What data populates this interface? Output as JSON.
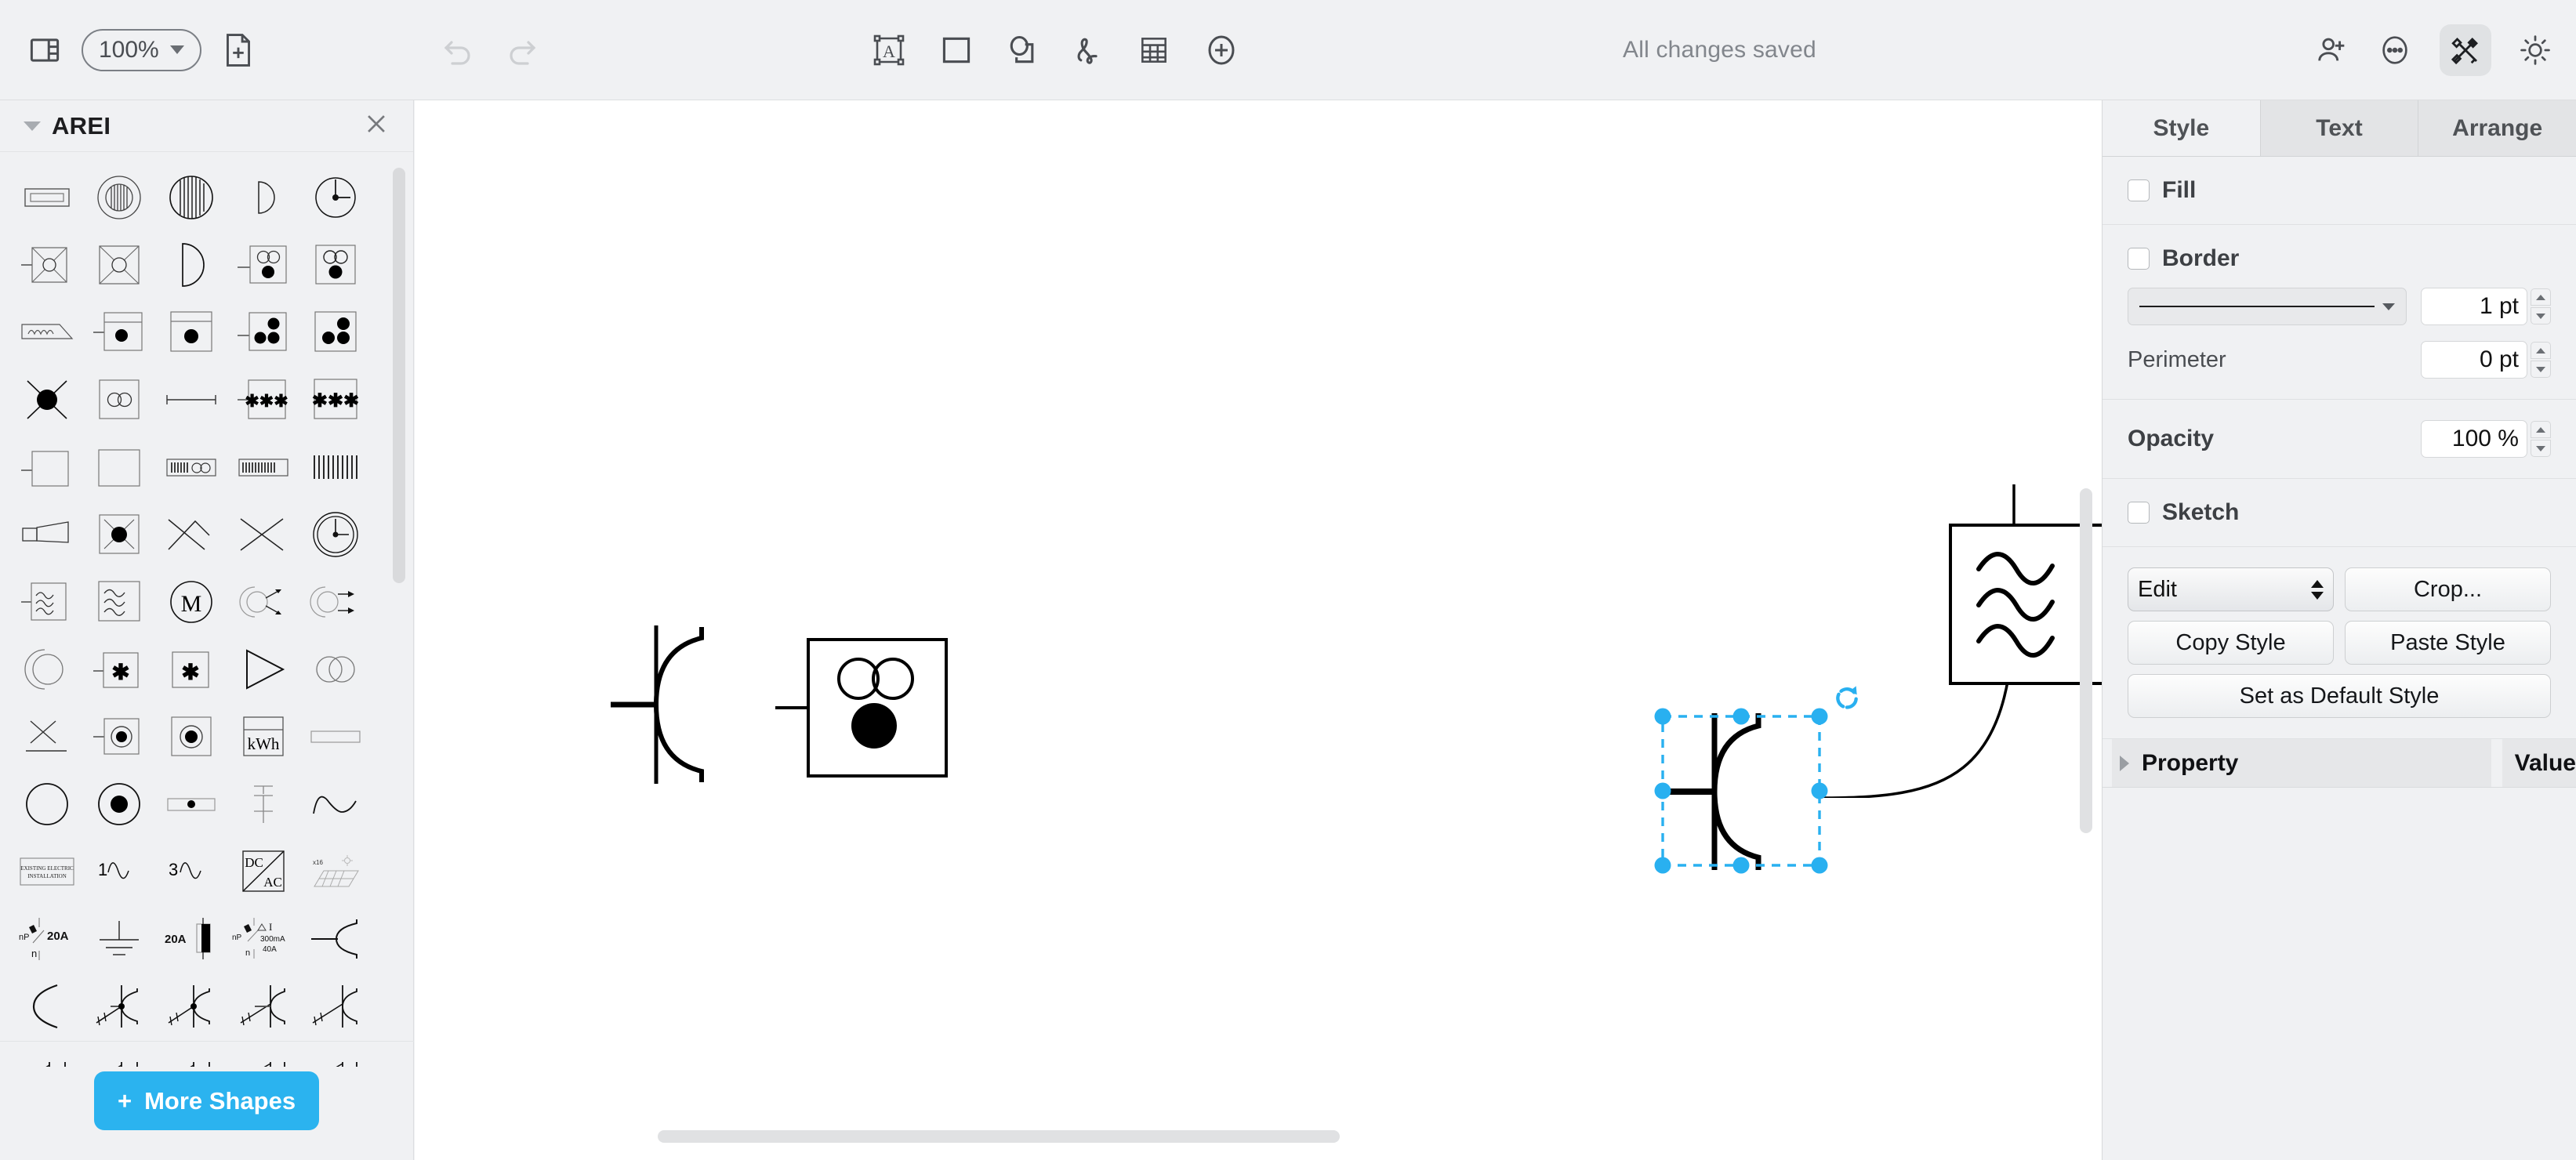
{
  "toolbar": {
    "zoom_value": "100%",
    "icons": {
      "layout_panel": "panel-layout-icon",
      "new_page": "new-page-icon",
      "undo": "undo-icon",
      "redo": "redo-icon",
      "text": "text-box-icon",
      "rectangle": "rectangle-icon",
      "shapes": "shape-icon",
      "freehand": "freehand-icon",
      "table": "table-icon",
      "add": "plus-circle-icon",
      "share": "add-person-icon",
      "more": "more-options-icon",
      "format": "format-tools-icon",
      "theme": "sun-icon"
    },
    "status": "All changes saved"
  },
  "left_panel": {
    "palette_title": "AREI",
    "close_label": "×",
    "more_shapes_label": "More Shapes",
    "more_shapes_plus": "+",
    "shape_labels": [
      "socket-flush",
      "ventilator-round-outlet",
      "ventilator-round",
      "half-disc-small",
      "clock-meter",
      "crossed-box-circle",
      "crossed-box-circle-large",
      "half-disc",
      "socket-two-circles",
      "box-two-circles-dot",
      "inductor-wedge",
      "box-dot-lamp",
      "box-dot-lamp-large",
      "box-three-dots",
      "box-three-dots-large",
      "junction-star-dot",
      "box-two-circles",
      "line-terminated",
      "box-three-asterisks",
      "box-three-asterisks-large",
      "open-rect",
      "plain-rect",
      "heater-with-circles",
      "heater-element",
      "heater-bars",
      "speaker-horn",
      "box-junction-dot",
      "crossed-lines-bent",
      "crossed-lines",
      "gauge-clock",
      "box-waves",
      "box-waves-large",
      "motor-m",
      "rotary-actuator-two-arrows",
      "rotary-actuator-arrows",
      "circle-arc",
      "box-asterisk-lamp",
      "box-asterisk",
      "amplifier-triangle",
      "two-circles-overlap",
      "cross-on-line",
      "box-circle-dot",
      "box-circle-dot-large",
      "kwh-meter",
      "flat-rect",
      "circle-plain",
      "circle-filled-dot",
      "rect-with-dot",
      "capacitor-ground",
      "sine-wave",
      "existing-electric-installation",
      "single-phase-wave",
      "three-phase-wave",
      "dc-ac-converter",
      "solar-panel-x16",
      "breaker-20a",
      "earth-ground",
      "fuse-20a",
      "rcd-300ma-40a",
      "switch-arc",
      "arc-only",
      "switch-arc-dot-slashes",
      "switch-arc-dot",
      "switch-arc-slashes-line",
      "switch-arc-slashes"
    ],
    "shape_texts": {
      "motor": "M",
      "asterisk": "✱",
      "kwh": "kWh",
      "existing_line1": "EXISTING ELECTRIC",
      "existing_line2": "INSTALLATION",
      "one": "1",
      "three": "3",
      "dc": "DC",
      "ac": "AC",
      "x16": "x16",
      "np": "nP",
      "n": "n",
      "amps_20a": "20A",
      "fuse_20a": "20A",
      "delta_i": "ΔI",
      "ma_300": "300mA",
      "amps_40a": "40A",
      "stars": "✱✱✱"
    }
  },
  "right_panel": {
    "tabs": [
      {
        "label": "Style",
        "active": true
      },
      {
        "label": "Text",
        "active": false
      },
      {
        "label": "Arrange",
        "active": false
      }
    ],
    "fill_label": "Fill",
    "fill_checked": false,
    "border_label": "Border",
    "border_checked": false,
    "border_width": "1 pt",
    "perimeter_label": "Perimeter",
    "perimeter_value": "0 pt",
    "opacity_label": "Opacity",
    "opacity_value": "100 %",
    "sketch_label": "Sketch",
    "sketch_checked": false,
    "edit_label": "Edit",
    "crop_label": "Crop...",
    "copy_style_label": "Copy Style",
    "paste_style_label": "Paste Style",
    "set_default_label": "Set as Default Style",
    "property_header": "Property",
    "value_header": "Value"
  },
  "canvas": {
    "shapes": [
      {
        "name": "switch-arc-symbol",
        "selected": false
      },
      {
        "name": "box-two-circles-dot-symbol",
        "selected": false
      },
      {
        "name": "switch-arc-symbol-selected",
        "selected": true
      },
      {
        "name": "box-waves-symbol",
        "selected": false
      }
    ],
    "selection": {
      "rotate_handle": "rotate-icon",
      "handle_color": "#29b0f0",
      "handle_count": 8
    }
  },
  "colors": {
    "accent": "#2bb3ef",
    "selection": "#29b0f0",
    "chrome_bg": "#f0f1f3",
    "canvas_bg": "#ffffff",
    "text": "#3c3c3c",
    "muted_text": "#82868c"
  }
}
